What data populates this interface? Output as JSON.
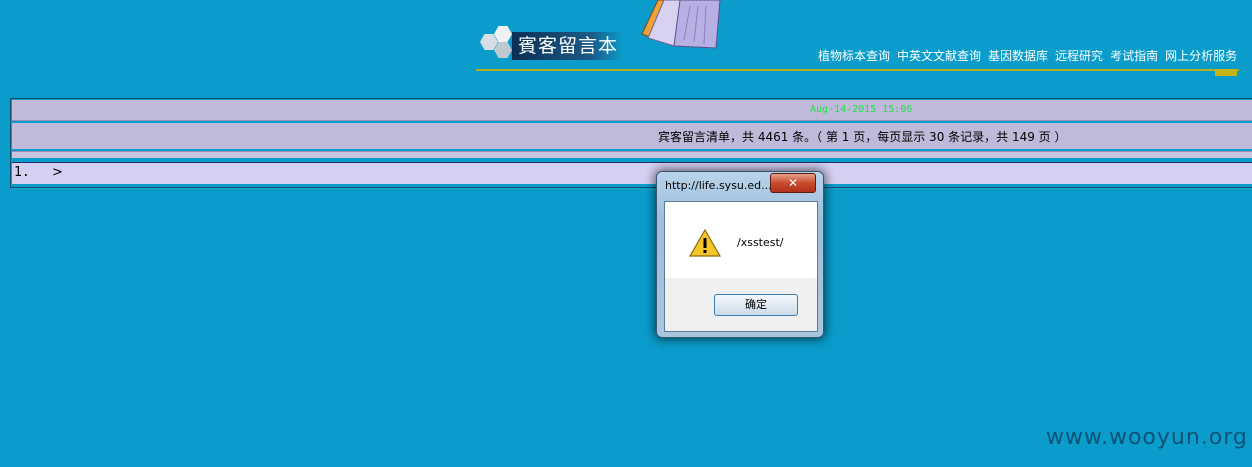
{
  "header": {
    "site_title": "賓客留言本",
    "nav": [
      {
        "label": "植物标本查询"
      },
      {
        "label": "中英文文献查询"
      },
      {
        "label": "基因数据库"
      },
      {
        "label": "远程研究"
      },
      {
        "label": "考试指南"
      },
      {
        "label": "网上分析服务"
      }
    ]
  },
  "board": {
    "date": "Aug-14-2015 15:06",
    "summary": "宾客留言清单，共 4461 条。（ 第 1 页，每页显示 30 条记录，共 149 页 ）",
    "entries": [
      {
        "number": "1.",
        "content": ">"
      }
    ]
  },
  "alert": {
    "title": "http://life.sysu.ed...",
    "close_label": "✕",
    "message": "/xsstest/",
    "ok_label": "确定",
    "icon": "warning-icon"
  },
  "watermark": "www.wooyun.org",
  "colors": {
    "page_background": "#0a9dcc",
    "row_background": "#c0b9d9",
    "entry_background": "#d4d0f2",
    "date_text": "#19e640",
    "header_rule": "#b8ad1c"
  }
}
